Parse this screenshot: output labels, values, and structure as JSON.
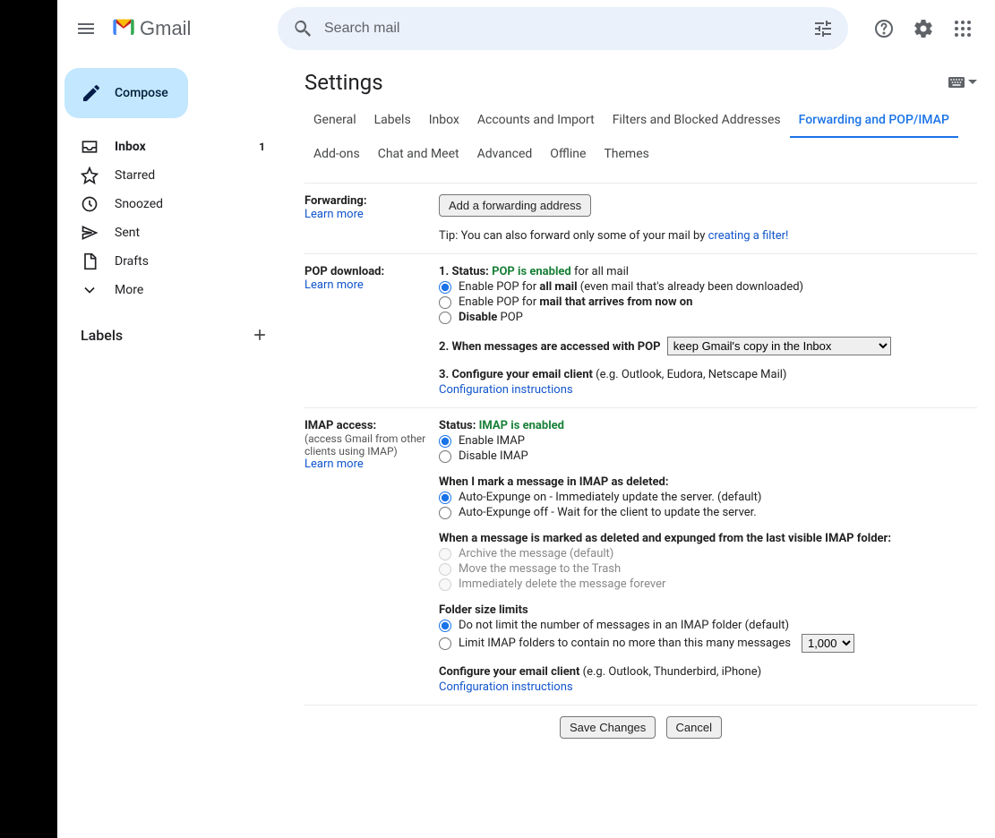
{
  "app": {
    "name": "Gmail"
  },
  "search": {
    "placeholder": "Search mail"
  },
  "compose": "Compose",
  "sidebar": {
    "items": [
      {
        "label": "Inbox",
        "count": "1"
      },
      {
        "label": "Starred"
      },
      {
        "label": "Snoozed"
      },
      {
        "label": "Sent"
      },
      {
        "label": "Drafts"
      },
      {
        "label": "More"
      }
    ],
    "labels_header": "Labels"
  },
  "settings": {
    "title": "Settings",
    "tabs": [
      "General",
      "Labels",
      "Inbox",
      "Accounts and Import",
      "Filters and Blocked Addresses",
      "Forwarding and POP/IMAP",
      "Add-ons",
      "Chat and Meet",
      "Advanced",
      "Offline",
      "Themes"
    ],
    "active_tab": "Forwarding and POP/IMAP"
  },
  "forwarding": {
    "heading": "Forwarding:",
    "learn": "Learn more",
    "add_button": "Add a forwarding address",
    "tip_prefix": "Tip: You can also forward only some of your mail by ",
    "tip_link": "creating a filter!"
  },
  "pop": {
    "heading": "POP download:",
    "learn": "Learn more",
    "status_prefix": "1. Status: ",
    "status_value": "POP is enabled",
    "status_suffix": " for all mail",
    "opt1_prefix": "Enable POP for ",
    "opt1_b": "all mail",
    "opt1_suffix": " (even mail that's already been downloaded)",
    "opt2_prefix": "Enable POP for ",
    "opt2_b": "mail that arrives from now on",
    "opt3_b": "Disable",
    "opt3_suffix": " POP",
    "q2": "2. When messages are accessed with POP",
    "q2_select_value": "keep Gmail's copy in the Inbox",
    "q3_b": "3. Configure your email client",
    "q3_suffix": " (e.g. Outlook, Eudora, Netscape Mail)",
    "config_link": "Configuration instructions"
  },
  "imap": {
    "heading": "IMAP access:",
    "note": "(access Gmail from other clients using IMAP)",
    "learn": "Learn more",
    "status_prefix": "Status: ",
    "status_value": "IMAP is enabled",
    "enable": "Enable IMAP",
    "disable": "Disable IMAP",
    "deleted_heading": "When I mark a message in IMAP as deleted:",
    "auto_on": "Auto-Expunge on - Immediately update the server. (default)",
    "auto_off": "Auto-Expunge off - Wait for the client to update the server.",
    "expunged_heading": "When a message is marked as deleted and expunged from the last visible IMAP folder:",
    "exp_opt1": "Archive the message (default)",
    "exp_opt2": "Move the message to the Trash",
    "exp_opt3": "Immediately delete the message forever",
    "folder_heading": "Folder size limits",
    "folder_opt1": "Do not limit the number of messages in an IMAP folder (default)",
    "folder_opt2": "Limit IMAP folders to contain no more than this many messages",
    "folder_select": "1,000",
    "configure_b": "Configure your email client",
    "configure_suffix": " (e.g. Outlook, Thunderbird, iPhone)",
    "config_link": "Configuration instructions"
  },
  "footer": {
    "save": "Save Changes",
    "cancel": "Cancel"
  }
}
